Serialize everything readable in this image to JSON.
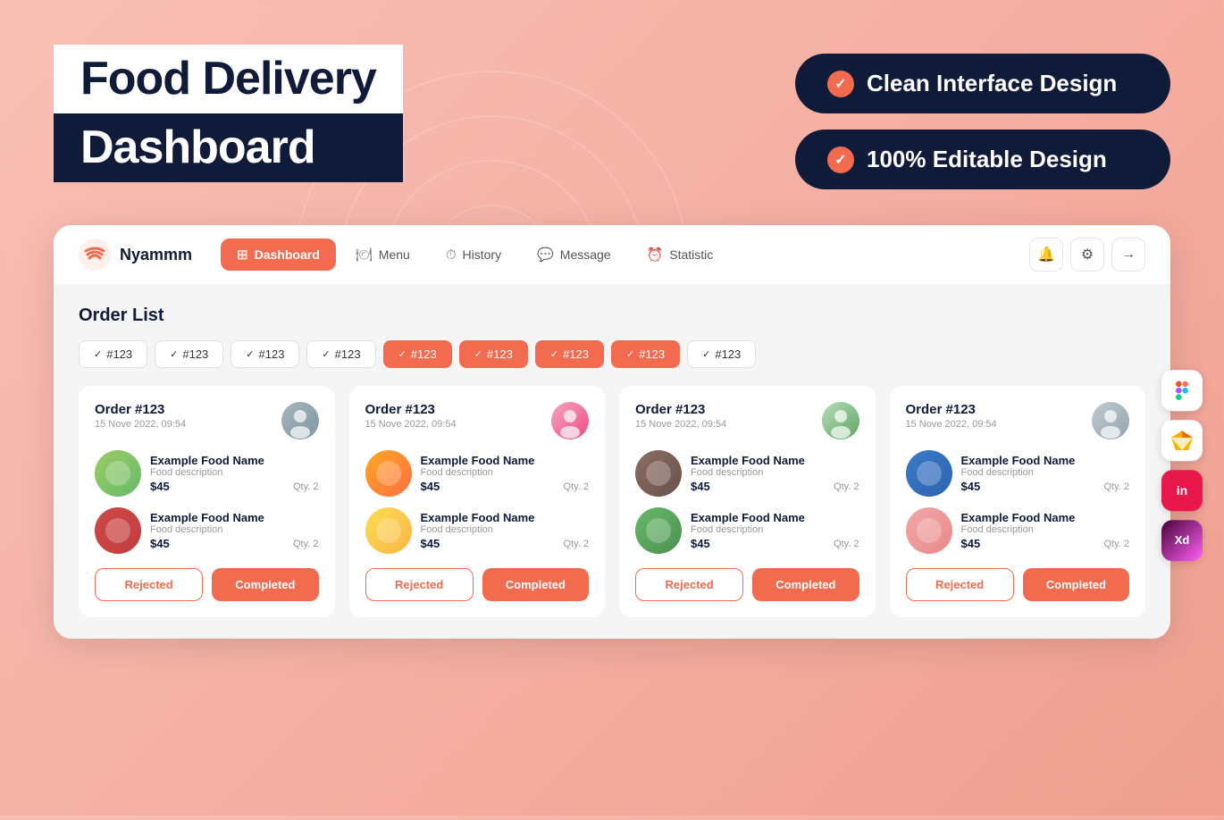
{
  "hero": {
    "title_line1": "Food Delivery",
    "title_line2": "Dashboard",
    "badges": [
      {
        "id": "badge-1",
        "text": "Clean Interface Design",
        "check": "✓"
      },
      {
        "id": "badge-2",
        "text": "100% Editable Design",
        "check": "✓"
      }
    ]
  },
  "navbar": {
    "brand_name": "Nyammm",
    "nav_items": [
      {
        "id": "nav-dashboard",
        "label": "Dashboard",
        "active": true
      },
      {
        "id": "nav-menu",
        "label": "Menu",
        "active": false
      },
      {
        "id": "nav-history",
        "label": "History",
        "active": false
      },
      {
        "id": "nav-message",
        "label": "Message",
        "active": false
      },
      {
        "id": "nav-statistic",
        "label": "Statistic",
        "active": false
      }
    ]
  },
  "section_title": "Order List",
  "filter_tags": [
    {
      "label": "#123",
      "active": false
    },
    {
      "label": "#123",
      "active": false
    },
    {
      "label": "#123",
      "active": false
    },
    {
      "label": "#123",
      "active": false
    },
    {
      "label": "#123",
      "active": true
    },
    {
      "label": "#123",
      "active": true
    },
    {
      "label": "#123",
      "active": true
    },
    {
      "label": "#123",
      "active": true
    },
    {
      "label": "#123",
      "active": false
    }
  ],
  "orders": [
    {
      "id": "Order #123",
      "date": "15 Nove 2022, 09:54",
      "avatar_color": "avatar-color-1",
      "items": [
        {
          "name": "Example Food Name",
          "desc": "Food description",
          "price": "$45",
          "qty": "Qty. 2",
          "color": "food-color-1"
        },
        {
          "name": "Example Food Name",
          "desc": "Food description",
          "price": "$45",
          "qty": "Qty. 2",
          "color": "food-color-5"
        }
      ],
      "btn_rejected": "Rejected",
      "btn_completed": "Completed"
    },
    {
      "id": "Order #123",
      "date": "15 Nove 2022, 09:54",
      "avatar_color": "avatar-color-2",
      "items": [
        {
          "name": "Example Food Name",
          "desc": "Food description",
          "price": "$45",
          "qty": "Qty. 2",
          "color": "food-color-2"
        },
        {
          "name": "Example Food Name",
          "desc": "Food description",
          "price": "$45",
          "qty": "Qty. 2",
          "color": "food-color-4"
        }
      ],
      "btn_rejected": "Rejected",
      "btn_completed": "Completed"
    },
    {
      "id": "Order #123",
      "date": "15 Nove 2022, 09:54",
      "avatar_color": "avatar-color-3",
      "items": [
        {
          "name": "Example Food Name",
          "desc": "Food description",
          "price": "$45",
          "qty": "Qty. 2",
          "color": "food-color-3"
        },
        {
          "name": "Example Food Name",
          "desc": "Food description",
          "price": "$45",
          "qty": "Qty. 2",
          "color": "food-color-7"
        }
      ],
      "btn_rejected": "Rejected",
      "btn_completed": "Completed"
    },
    {
      "id": "Order #123",
      "date": "15 Nove 2022, 09:54",
      "avatar_color": "avatar-color-4",
      "items": [
        {
          "name": "Example Food Name",
          "desc": "Food description",
          "price": "$45",
          "qty": "Qty. 2",
          "color": "food-color-6"
        },
        {
          "name": "Example Food Name",
          "desc": "Food description",
          "price": "$45",
          "qty": "Qty. 2",
          "color": "food-color-8"
        }
      ],
      "btn_rejected": "Rejected",
      "btn_completed": "Completed"
    }
  ],
  "side_tools": [
    {
      "id": "figma",
      "label": "F",
      "style": "figma"
    },
    {
      "id": "sketch",
      "label": "◇",
      "style": "sketch"
    },
    {
      "id": "invision",
      "label": "in",
      "style": "invision"
    },
    {
      "id": "xd",
      "label": "Xd",
      "style": "xd"
    }
  ]
}
